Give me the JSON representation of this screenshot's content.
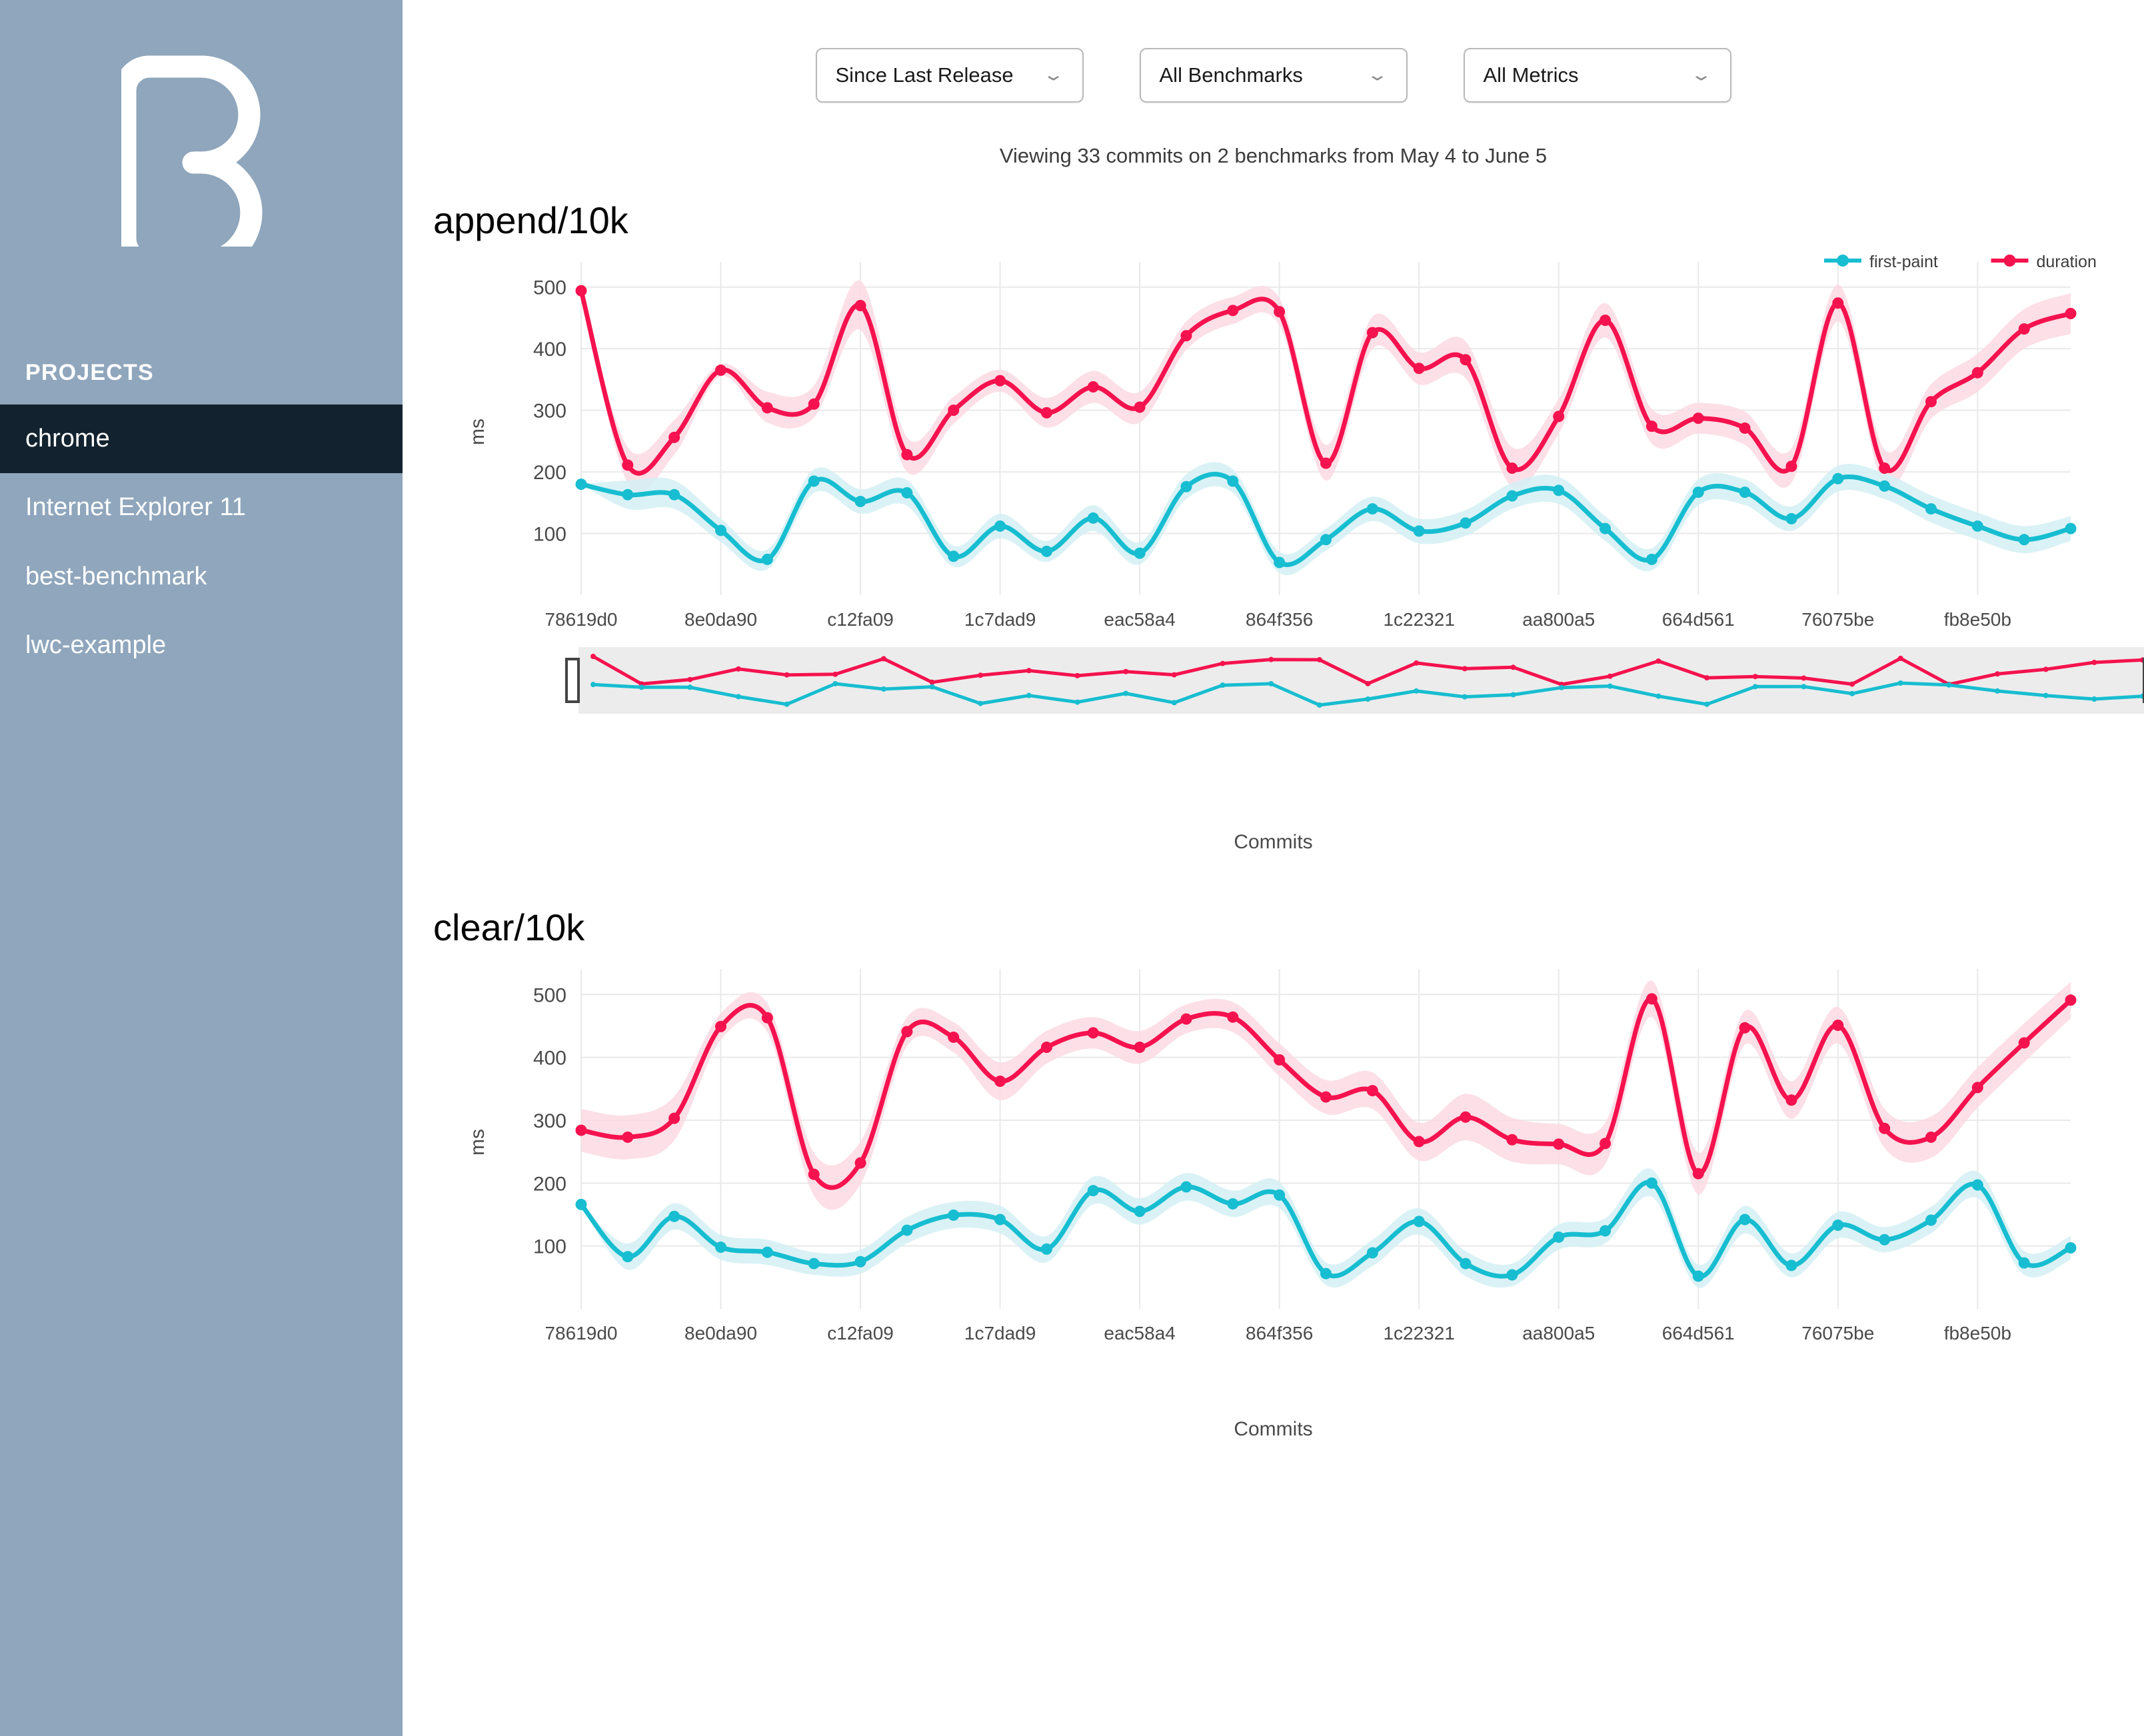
{
  "sidebar": {
    "logo_icon": "b-logo-icon",
    "section_label": "PROJECTS",
    "items": [
      {
        "label": "chrome",
        "active": true
      },
      {
        "label": "Internet Explorer 11",
        "active": false
      },
      {
        "label": "best-benchmark",
        "active": false
      },
      {
        "label": "lwc-example",
        "active": false
      }
    ],
    "bg_color": "#8fa6bc",
    "active_bg_color": "#12232f"
  },
  "filters": [
    {
      "name": "range-select",
      "value": "Since Last Release",
      "icon": "chevron-down-icon"
    },
    {
      "name": "benchmark-select",
      "value": "All Benchmarks",
      "icon": "chevron-down-icon"
    },
    {
      "name": "metric-select",
      "value": "All Metrics",
      "icon": "chevron-down-icon"
    }
  ],
  "summary": "Viewing 33 commits on 2 benchmarks from May 4 to June 5",
  "colors": {
    "duration": "#f5124e",
    "first_paint": "#17bdd0",
    "duration_band": "#fbd9e3",
    "first_paint_band": "#d4f0f5",
    "grid": "#e9e9e9",
    "brush_bg": "#ececec"
  },
  "legend": [
    {
      "label": "first-paint",
      "color": "#17bdd0"
    },
    {
      "label": "duration",
      "color": "#f5124e"
    }
  ],
  "axis": {
    "ylabel": "ms",
    "xlabel": "Commits",
    "yticks": [
      100,
      200,
      300,
      400,
      500
    ],
    "ylim": [
      0,
      530
    ],
    "xticks": [
      "78619d0",
      "8e0da90",
      "c12fa09",
      "1c7dad9",
      "eac58a4",
      "864f356",
      "1c22321",
      "aa800a5",
      "664d561",
      "76075be",
      "fb8e50b"
    ]
  },
  "chart_data": [
    {
      "type": "line",
      "title": "append/10k",
      "xlabel": "Commits",
      "ylabel": "ms",
      "ylim": [
        0,
        530
      ],
      "yticks": [
        100,
        200,
        300,
        400,
        500
      ],
      "grid": true,
      "legend_position": "top-right",
      "has_brush": true,
      "categories": [
        "78619d0",
        "",
        "",
        "8e0da90",
        "",
        "",
        "c12fa09",
        "",
        "",
        "1c7dad9",
        "",
        "",
        "eac58a4",
        "",
        "",
        "864f356",
        "",
        "",
        "1c22321",
        "",
        "",
        "aa800a5",
        "",
        "",
        "664d561",
        "",
        "",
        "76075be",
        "",
        "",
        "fb8e50b",
        "",
        ""
      ],
      "series": [
        {
          "name": "duration",
          "color": "#f5124e",
          "values": [
            494,
            211,
            256,
            365,
            304,
            310,
            470,
            228,
            300,
            348,
            296,
            338,
            305,
            421,
            462,
            460,
            214,
            426,
            368,
            382,
            206,
            290,
            446,
            274,
            287,
            271,
            209,
            474,
            206,
            314,
            361,
            432,
            457
          ],
          "band_lower": [
            494,
            182,
            228,
            355,
            280,
            288,
            430,
            200,
            278,
            330,
            272,
            312,
            280,
            398,
            440,
            438,
            186,
            400,
            342,
            352,
            176,
            262,
            418,
            246,
            262,
            244,
            182,
            444,
            178,
            286,
            330,
            400,
            424
          ],
          "band_upper": [
            494,
            240,
            284,
            375,
            330,
            340,
            510,
            256,
            322,
            366,
            320,
            364,
            330,
            444,
            484,
            482,
            244,
            452,
            394,
            412,
            240,
            318,
            474,
            302,
            312,
            298,
            238,
            504,
            236,
            342,
            392,
            464,
            490
          ]
        },
        {
          "name": "first-paint",
          "color": "#17bdd0",
          "values": [
            180,
            163,
            163,
            105,
            58,
            185,
            152,
            166,
            63,
            112,
            71,
            125,
            68,
            176,
            185,
            53,
            90,
            140,
            104,
            117,
            161,
            170,
            108,
            58,
            167,
            167,
            124,
            189,
            177,
            140,
            112,
            90,
            108
          ],
          "band_lower": [
            180,
            140,
            140,
            86,
            42,
            166,
            132,
            145,
            46,
            92,
            54,
            104,
            50,
            156,
            166,
            36,
            72,
            120,
            84,
            96,
            140,
            148,
            88,
            40,
            146,
            146,
            104,
            168,
            156,
            118,
            90,
            68,
            88
          ],
          "band_upper": [
            180,
            186,
            186,
            124,
            74,
            204,
            172,
            187,
            80,
            132,
            88,
            146,
            86,
            196,
            204,
            70,
            108,
            160,
            124,
            138,
            182,
            192,
            128,
            76,
            188,
            188,
            144,
            210,
            198,
            162,
            134,
            112,
            128
          ]
        }
      ]
    },
    {
      "type": "line",
      "title": "clear/10k",
      "xlabel": "Commits",
      "ylabel": "ms",
      "ylim": [
        0,
        530
      ],
      "yticks": [
        100,
        200,
        300,
        400,
        500
      ],
      "grid": true,
      "legend_position": "none",
      "has_brush": false,
      "categories": [
        "78619d0",
        "",
        "",
        "8e0da90",
        "",
        "",
        "c12fa09",
        "",
        "",
        "1c7dad9",
        "",
        "",
        "eac58a4",
        "",
        "",
        "864f356",
        "",
        "",
        "1c22321",
        "",
        "",
        "aa800a5",
        "",
        "",
        "664d561",
        "",
        "",
        "76075be",
        "",
        "",
        "fb8e50b",
        "",
        ""
      ],
      "series": [
        {
          "name": "duration",
          "color": "#f5124e",
          "values": [
            284,
            273,
            303,
            449,
            463,
            214,
            232,
            441,
            432,
            362,
            416,
            439,
            416,
            461,
            464,
            396,
            337,
            347,
            266,
            305,
            269,
            262,
            263,
            493,
            215,
            447,
            332,
            451,
            287,
            273,
            352,
            423,
            491
          ],
          "band_lower": [
            250,
            238,
            268,
            428,
            440,
            180,
            198,
            418,
            408,
            332,
            390,
            414,
            390,
            438,
            440,
            370,
            310,
            318,
            236,
            268,
            234,
            230,
            230,
            464,
            182,
            420,
            302,
            422,
            256,
            240,
            320,
            392,
            462
          ],
          "band_upper": [
            318,
            308,
            338,
            470,
            486,
            248,
            266,
            464,
            456,
            392,
            442,
            464,
            442,
            484,
            488,
            422,
            364,
            376,
            296,
            342,
            304,
            294,
            296,
            522,
            248,
            474,
            362,
            480,
            318,
            306,
            384,
            454,
            520
          ]
        },
        {
          "name": "first-paint",
          "color": "#17bdd0",
          "values": [
            166,
            83,
            147,
            98,
            90,
            72,
            75,
            125,
            149,
            142,
            95,
            188,
            155,
            194,
            167,
            181,
            56,
            89,
            139,
            72,
            54,
            114,
            124,
            200,
            52,
            142,
            69,
            133,
            110,
            141,
            197,
            73,
            97
          ],
          "band_lower": [
            166,
            62,
            126,
            78,
            70,
            54,
            56,
            104,
            128,
            120,
            74,
            166,
            134,
            172,
            146,
            160,
            38,
            68,
            118,
            52,
            36,
            94,
            104,
            178,
            34,
            120,
            50,
            112,
            90,
            120,
            176,
            54,
            78
          ],
          "band_upper": [
            166,
            104,
            168,
            118,
            110,
            90,
            94,
            146,
            170,
            164,
            116,
            210,
            176,
            216,
            188,
            202,
            74,
            110,
            160,
            92,
            72,
            134,
            144,
            222,
            70,
            164,
            88,
            154,
            130,
            162,
            218,
            92,
            116
          ]
        }
      ]
    }
  ],
  "brush": {
    "name": "commit-range-brush",
    "left_handle": "brush-handle-left",
    "right_handle": "brush-handle-right"
  }
}
